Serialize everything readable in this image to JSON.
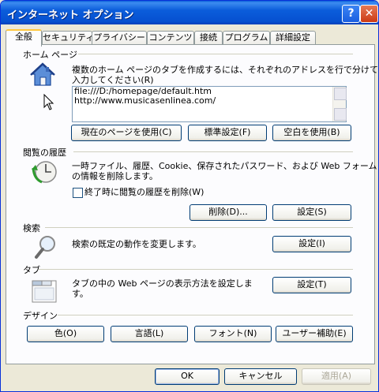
{
  "window": {
    "title": "インターネット オプション",
    "help_label": "?",
    "close_label": "✕"
  },
  "tabs": [
    "全般",
    "セキュリティ",
    "プライバシー",
    "コンテンツ",
    "接続",
    "プログラム",
    "詳細設定"
  ],
  "home": {
    "title": "ホーム ページ",
    "description_line1": "複数のホーム ページのタブを作成するには、それぞれのアドレスを行で分けて",
    "description_line2": "入力してください(R)",
    "urls": [
      "file:///D:/homepage/default.htm",
      "http://www.musicasenlinea.com/"
    ],
    "btn_current": "現在のページを使用(C)",
    "btn_default": "標準設定(F)",
    "btn_blank": "空白を使用(B)"
  },
  "history": {
    "title": "閲覧の履歴",
    "description_line1": "一時ファイル、履歴、Cookie、保存されたパスワード、および Web フォーム",
    "description_line2": "の情報を削除します。",
    "checkbox_label": "終了時に閲覧の履歴を削除(W)",
    "checkbox_checked": false,
    "btn_delete": "削除(D)...",
    "btn_settings": "設定(S)"
  },
  "search": {
    "title": "検索",
    "description": "検索の既定の動作を変更します。",
    "btn_settings": "設定(I)"
  },
  "tabsection": {
    "title": "タブ",
    "description_line1": "タブの中の Web ページの表示方法を設定しま",
    "description_line2": "す。",
    "btn_settings": "設定(T)"
  },
  "design": {
    "title": "デザイン",
    "btn_colors": "色(O)",
    "btn_languages": "言語(L)",
    "btn_fonts": "フォント(N)",
    "btn_accessibility": "ユーザー補助(E)"
  },
  "footer": {
    "ok": "OK",
    "cancel": "キャンセル",
    "apply": "適用(A)"
  },
  "colors": {
    "titlebar": "#0b5ddb",
    "tab_highlight": "#ffc73c",
    "panel": "#fcfcfe"
  }
}
